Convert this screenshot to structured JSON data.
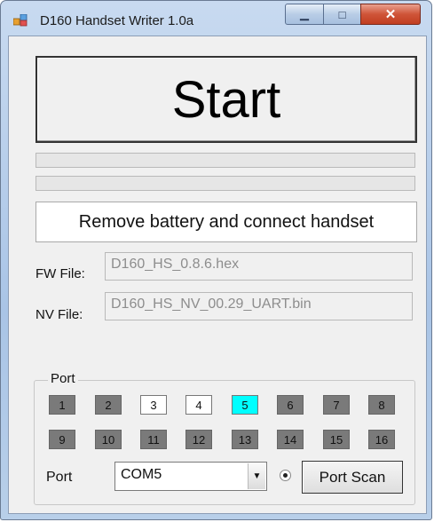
{
  "window": {
    "title": "D160 Handset Writer 1.0a",
    "minimize_glyph": "▁",
    "maximize_glyph": "□",
    "close_glyph": "✕",
    "icon": "app-icon"
  },
  "start_button": {
    "label": "Start"
  },
  "progress": {
    "bar1_fraction": 0,
    "bar2_fraction": 0
  },
  "message": "Remove battery and connect handset",
  "fw": {
    "label": "FW File:",
    "value": "D160_HS_0.8.6.hex"
  },
  "nv": {
    "label": "NV File:",
    "value": "D160_HS_NV_00.29_UART.bin"
  },
  "port_group": {
    "title": "Port",
    "ports": [
      {
        "label": "1",
        "state": "off"
      },
      {
        "label": "2",
        "state": "off"
      },
      {
        "label": "3",
        "state": "on"
      },
      {
        "label": "4",
        "state": "on"
      },
      {
        "label": "5",
        "state": "selected"
      },
      {
        "label": "6",
        "state": "off"
      },
      {
        "label": "7",
        "state": "off"
      },
      {
        "label": "8",
        "state": "off"
      },
      {
        "label": "9",
        "state": "off"
      },
      {
        "label": "10",
        "state": "off"
      },
      {
        "label": "11",
        "state": "off"
      },
      {
        "label": "12",
        "state": "off"
      },
      {
        "label": "13",
        "state": "off"
      },
      {
        "label": "14",
        "state": "off"
      },
      {
        "label": "15",
        "state": "off"
      },
      {
        "label": "16",
        "state": "off"
      }
    ],
    "port_label": "Port",
    "selected_port": "COM5",
    "radio_checked": true,
    "scan_label": "Port Scan"
  },
  "colors": {
    "selected_port": "#00ffff",
    "inactive_port": "#7a7a7a",
    "available_port": "#ffffff"
  }
}
